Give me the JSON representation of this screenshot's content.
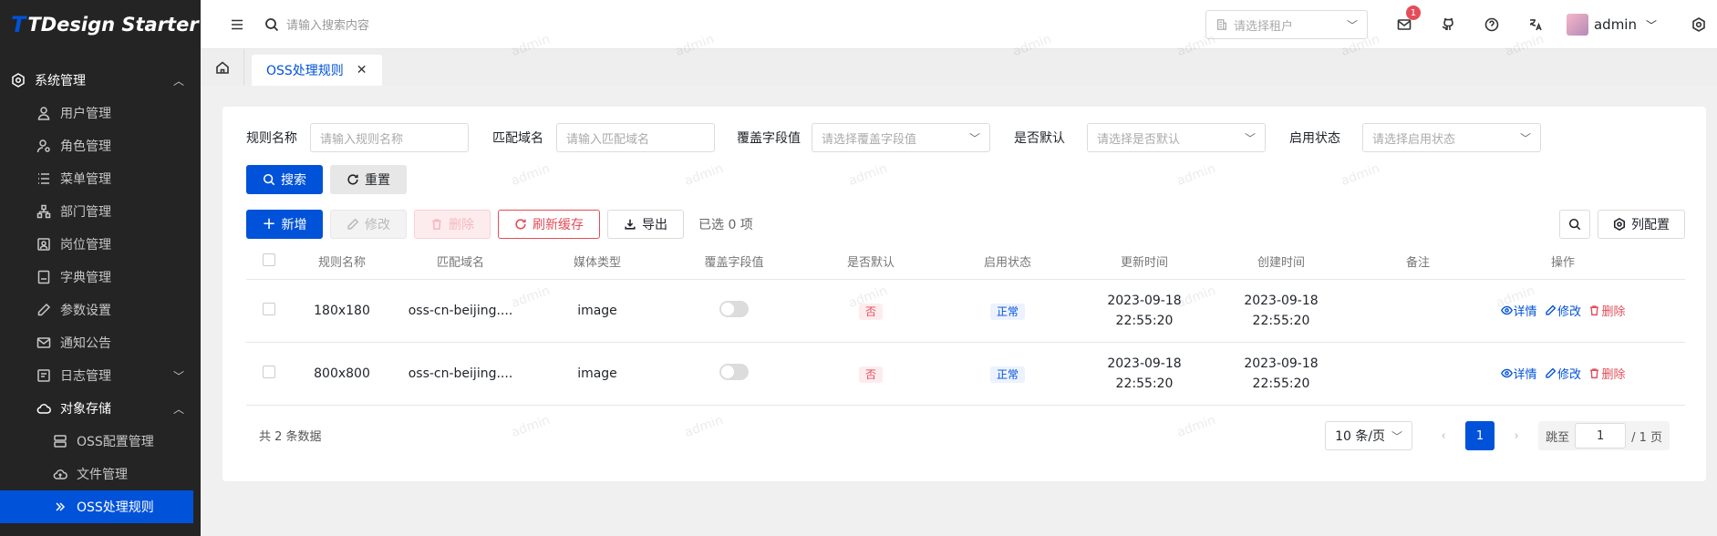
{
  "app": {
    "logo_mark": "T",
    "title": "TDesign Starter"
  },
  "sidebar": {
    "group": "系统管理",
    "items": [
      {
        "label": "用户管理",
        "icon": "user-icon"
      },
      {
        "label": "角色管理",
        "icon": "role-icon"
      },
      {
        "label": "菜单管理",
        "icon": "menu-list-icon"
      },
      {
        "label": "部门管理",
        "icon": "dept-icon"
      },
      {
        "label": "岗位管理",
        "icon": "post-icon"
      },
      {
        "label": "字典管理",
        "icon": "dict-icon"
      },
      {
        "label": "参数设置",
        "icon": "edit-icon"
      },
      {
        "label": "通知公告",
        "icon": "mail-icon"
      },
      {
        "label": "日志管理",
        "icon": "log-icon"
      },
      {
        "label": "对象存储",
        "icon": "cloud-icon"
      }
    ],
    "storage_children": [
      {
        "label": "OSS配置管理",
        "icon": "server-icon"
      },
      {
        "label": "文件管理",
        "icon": "cloud-upload-icon"
      },
      {
        "label": "OSS处理规则",
        "icon": "double-chevron-icon"
      }
    ]
  },
  "header": {
    "search_placeholder": "请输入搜索内容",
    "tenant_placeholder": "请选择租户",
    "notify_count": "1",
    "username": "admin"
  },
  "tabs": {
    "active": "OSS处理规则"
  },
  "filters": {
    "rule_name_label": "规则名称",
    "rule_name_placeholder": "请输入规则名称",
    "domain_label": "匹配域名",
    "domain_placeholder": "请输入匹配域名",
    "override_label": "覆盖字段值",
    "override_placeholder": "请选择覆盖字段值",
    "default_label": "是否默认",
    "default_placeholder": "请选择是否默认",
    "status_label": "启用状态",
    "status_placeholder": "请选择启用状态"
  },
  "buttons": {
    "search": "搜索",
    "reset": "重置",
    "add": "新增",
    "edit": "修改",
    "delete": "删除",
    "refresh_cache": "刷新缓存",
    "export": "导出",
    "selected": "已选 0 项",
    "column_config": "列配置"
  },
  "table": {
    "headers": [
      "规则名称",
      "匹配域名",
      "媒体类型",
      "覆盖字段值",
      "是否默认",
      "启用状态",
      "更新时间",
      "创建时间",
      "备注",
      "操作"
    ],
    "rows": [
      {
        "name": "180x180",
        "domain": "oss-cn-beijing....",
        "media": "image",
        "is_default": "否",
        "status": "正常",
        "update_date": "2023-09-18",
        "update_time": "22:55:20",
        "create_date": "2023-09-18",
        "create_time": "22:55:20",
        "remark": "",
        "op_detail": "详情",
        "op_edit": "修改",
        "op_delete": "删除"
      },
      {
        "name": "800x800",
        "domain": "oss-cn-beijing....",
        "media": "image",
        "is_default": "否",
        "status": "正常",
        "update_date": "2023-09-18",
        "update_time": "22:55:20",
        "create_date": "2023-09-18",
        "create_time": "22:55:20",
        "remark": "",
        "op_detail": "详情",
        "op_edit": "修改",
        "op_delete": "删除"
      }
    ]
  },
  "pagination": {
    "total": "共 2 条数据",
    "page_size": "10 条/页",
    "current": "1",
    "jump_label": "跳至",
    "jump_value": "1",
    "pages": "/ 1 页"
  },
  "watermark": "admin",
  "colors": {
    "primary": "#0052d9",
    "danger": "#e34d59",
    "sidebar_bg": "#242424"
  }
}
